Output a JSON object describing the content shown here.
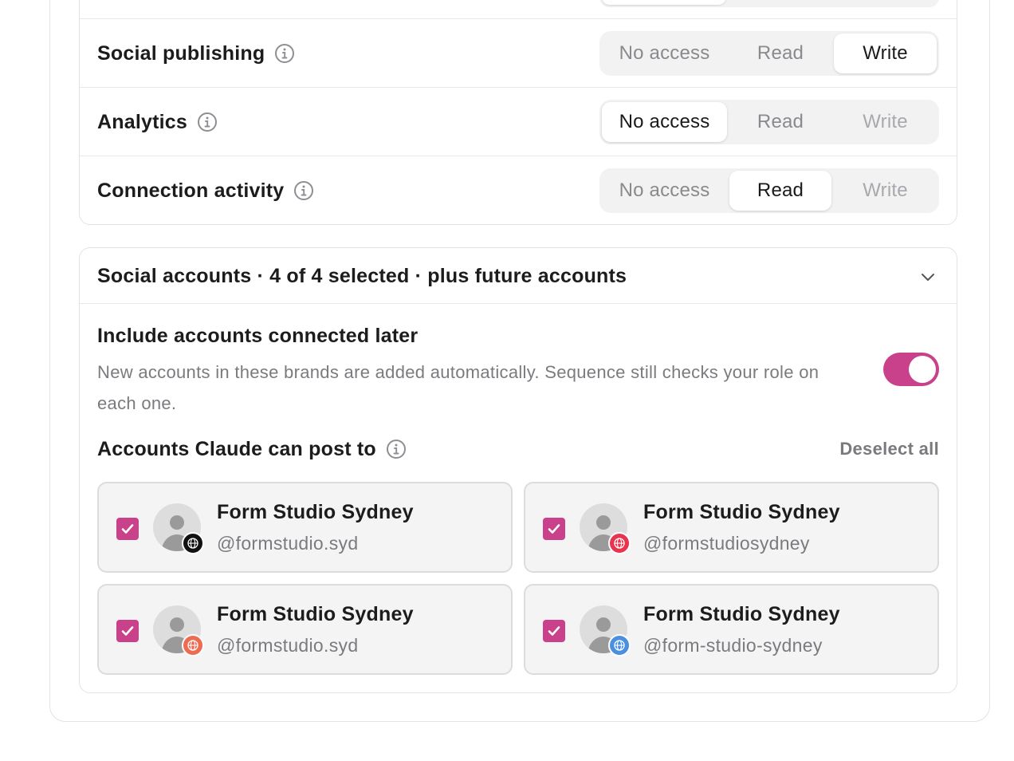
{
  "permissions": {
    "options": [
      "No access",
      "Read",
      "Write"
    ],
    "rows": [
      {
        "label": "Social publishing",
        "selected": "Write",
        "write_available": true
      },
      {
        "label": "Analytics",
        "selected": "No access",
        "write_available": false
      },
      {
        "label": "Connection activity",
        "selected": "Read",
        "write_available": false
      }
    ]
  },
  "social_accounts": {
    "header": "Social accounts · 4 of 4 selected · plus future accounts",
    "include_later": {
      "title": "Include accounts connected later",
      "description": "New accounts in these brands are added automatically. Sequence still checks your role on each one.",
      "enabled": true
    },
    "post_label": "Accounts Claude can post to",
    "deselect_label": "Deselect all",
    "accounts": [
      {
        "name": "Form Studio Sydney",
        "handle": "@formstudio.syd",
        "checked": true,
        "badge_color": "#111111"
      },
      {
        "name": "Form Studio Sydney",
        "handle": "@formstudiosydney",
        "checked": true,
        "badge_color": "#e8344e"
      },
      {
        "name": "Form Studio Sydney",
        "handle": "@formstudio.syd",
        "checked": true,
        "badge_color": "#ee6a50"
      },
      {
        "name": "Form Studio Sydney",
        "handle": "@form-studio-sydney",
        "checked": true,
        "badge_color": "#4a8fe0"
      }
    ]
  },
  "colors": {
    "accent": "#c8418a",
    "segment_bg": "#f2f2f3",
    "tile_bg": "#f4f4f5",
    "muted_text": "#7b7b7f"
  }
}
